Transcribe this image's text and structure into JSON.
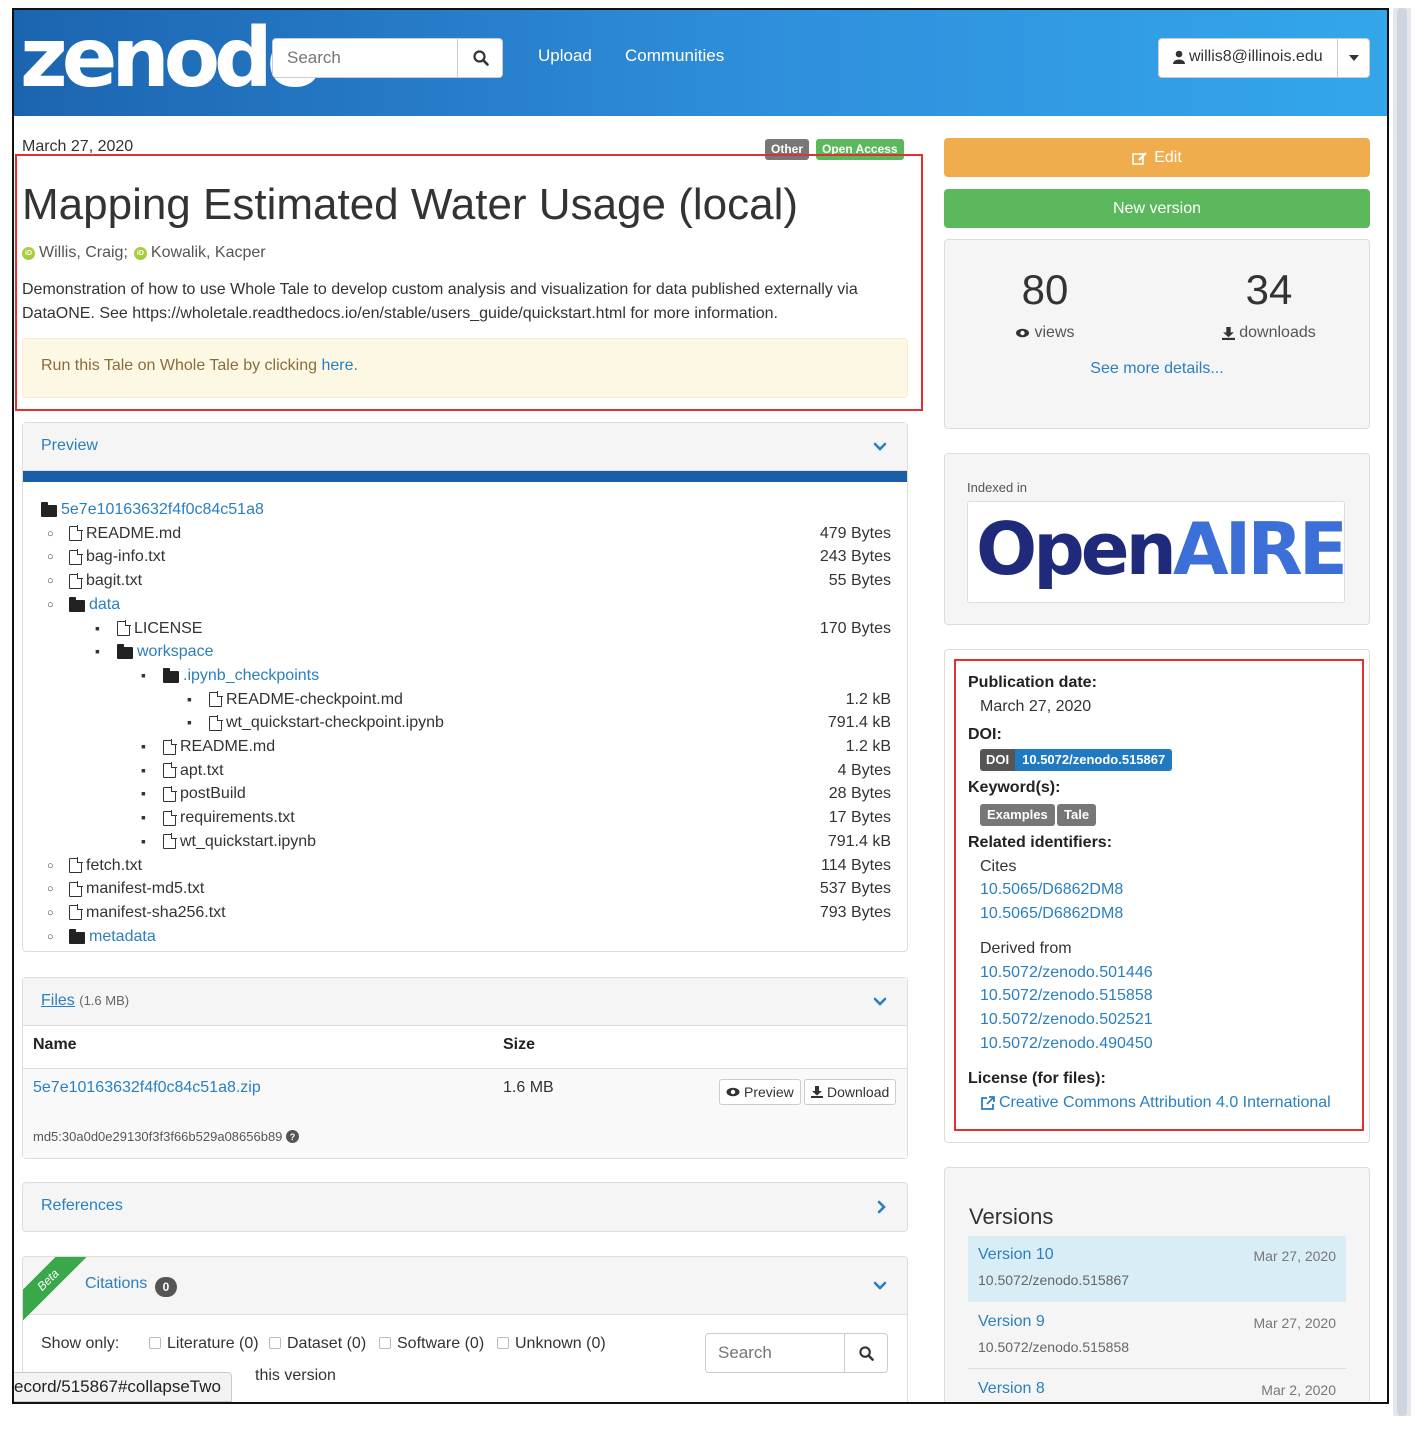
{
  "header": {
    "logo": "zenodo",
    "search_placeholder": "Search",
    "nav": {
      "upload": "Upload",
      "communities": "Communities"
    },
    "user_email": "willis8@illinois.edu"
  },
  "record": {
    "date": "March 27, 2020",
    "badges": {
      "type": "Other",
      "access": "Open Access"
    },
    "title": "Mapping Estimated Water Usage (local)",
    "authors": [
      "Willis, Craig;",
      "Kowalik, Kacper"
    ],
    "description_line1": "Demonstration of how to use Whole Tale to develop custom analysis and visualization for data published externally via",
    "description_line2": "DataONE. See https://wholetale.readthedocs.io/en/stable/users_guide/quickstart.html for more information.",
    "alert_text": "Run this Tale on Whole Tale by clicking ",
    "alert_link": "here."
  },
  "preview": {
    "title": "Preview",
    "tree": [
      {
        "name": "5e7e10163632f4f0c84c51a8",
        "kind": "dir",
        "level": 0,
        "size": ""
      },
      {
        "name": "README.md",
        "kind": "file",
        "level": 1,
        "size": "479 Bytes"
      },
      {
        "name": "bag-info.txt",
        "kind": "file",
        "level": 1,
        "size": "243 Bytes"
      },
      {
        "name": "bagit.txt",
        "kind": "file",
        "level": 1,
        "size": "55 Bytes"
      },
      {
        "name": "data",
        "kind": "dir",
        "level": 1,
        "size": ""
      },
      {
        "name": "LICENSE",
        "kind": "file",
        "level": 2,
        "size": "170 Bytes"
      },
      {
        "name": "workspace",
        "kind": "dir",
        "level": 2,
        "size": ""
      },
      {
        "name": ".ipynb_checkpoints",
        "kind": "dir",
        "level": 3,
        "size": ""
      },
      {
        "name": "README-checkpoint.md",
        "kind": "file",
        "level": 4,
        "size": "1.2 kB"
      },
      {
        "name": "wt_quickstart-checkpoint.ipynb",
        "kind": "file",
        "level": 4,
        "size": "791.4 kB"
      },
      {
        "name": "README.md",
        "kind": "file",
        "level": 3,
        "size": "1.2 kB"
      },
      {
        "name": "apt.txt",
        "kind": "file",
        "level": 3,
        "size": "4 Bytes"
      },
      {
        "name": "postBuild",
        "kind": "file",
        "level": 3,
        "size": "28 Bytes"
      },
      {
        "name": "requirements.txt",
        "kind": "file",
        "level": 3,
        "size": "17 Bytes"
      },
      {
        "name": "wt_quickstart.ipynb",
        "kind": "file",
        "level": 3,
        "size": "791.4 kB"
      },
      {
        "name": "fetch.txt",
        "kind": "file",
        "level": 1,
        "size": "114 Bytes"
      },
      {
        "name": "manifest-md5.txt",
        "kind": "file",
        "level": 1,
        "size": "537 Bytes"
      },
      {
        "name": "manifest-sha256.txt",
        "kind": "file",
        "level": 1,
        "size": "793 Bytes"
      },
      {
        "name": "metadata",
        "kind": "dir",
        "level": 1,
        "size": ""
      }
    ]
  },
  "files": {
    "title": "Files",
    "total": "(1.6 MB)",
    "col_name": "Name",
    "col_size": "Size",
    "file_name": "5e7e10163632f4f0c84c51a8.zip",
    "file_size": "1.6 MB",
    "preview_btn": "Preview",
    "download_btn": "Download",
    "md5": "md5:30a0d0e29130f3f3f66b529a08656b89"
  },
  "references": {
    "title": "References"
  },
  "citations": {
    "ribbon": "Beta",
    "title": "Citations",
    "count": "0",
    "show_only": "Show only:",
    "filters": [
      "Literature (0)",
      "Dataset (0)",
      "Software (0)",
      "Unknown (0)"
    ],
    "search_placeholder": "Search",
    "this_version": "this version"
  },
  "status_url": "ecord/515867#collapseTwo",
  "sidebar": {
    "edit": "Edit",
    "new_version": "New version",
    "views_count": "80",
    "views_label": "views",
    "downloads_count": "34",
    "downloads_label": "downloads",
    "see_more": "See more details...",
    "indexed_in": "Indexed in",
    "openaire": {
      "open": "Open",
      "aire": "AIRE"
    }
  },
  "metadata": {
    "pub_date_label": "Publication date:",
    "pub_date": "March 27, 2020",
    "doi_label": "DOI:",
    "doi_prefix": "DOI",
    "doi_value": "10.5072/zenodo.515867",
    "keywords_label": "Keyword(s):",
    "keywords": [
      "Examples",
      "Tale"
    ],
    "related_label": "Related identifiers:",
    "cites_label": "Cites",
    "cites": [
      "10.5065/D6862DM8",
      "10.5065/D6862DM8"
    ],
    "derived_label": "Derived from",
    "derived": [
      "10.5072/zenodo.501446",
      "10.5072/zenodo.515858",
      "10.5072/zenodo.502521",
      "10.5072/zenodo.490450"
    ],
    "license_label": "License (for files):",
    "license": "Creative Commons Attribution 4.0 International"
  },
  "versions": {
    "title": "Versions",
    "items": [
      {
        "name": "Version 10",
        "date": "Mar 27, 2020",
        "doi": "10.5072/zenodo.515867"
      },
      {
        "name": "Version 9",
        "date": "Mar 27, 2020",
        "doi": "10.5072/zenodo.515858"
      },
      {
        "name": "Version 8",
        "date": "Mar 2, 2020",
        "doi": ""
      }
    ]
  },
  "colors": {
    "header_blue": "#1c64b0",
    "link_blue": "#2a7fc0",
    "edit_orange": "#f0ad4e",
    "new_version_green": "#5cb85c",
    "highlight_red": "#e03030",
    "openaire_navy": "#1f2a7a",
    "openaire_blue": "#3d6fd8"
  }
}
